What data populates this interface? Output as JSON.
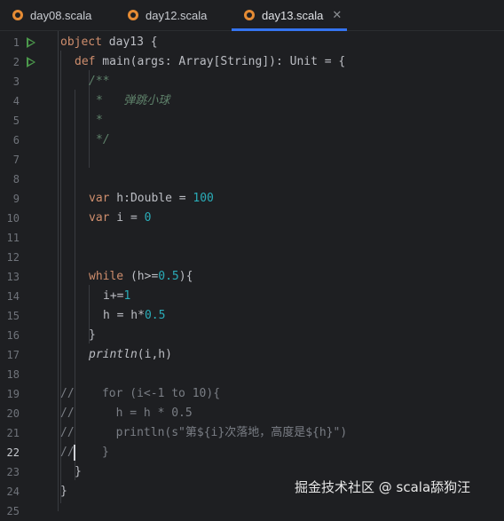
{
  "tabs": [
    {
      "label": "day08.scala",
      "active": false
    },
    {
      "label": "day12.scala",
      "active": false
    },
    {
      "label": "day13.scala",
      "active": true
    }
  ],
  "close_glyph": "✕",
  "line_numbers": [
    "1",
    "2",
    "3",
    "4",
    "5",
    "6",
    "7",
    "8",
    "9",
    "10",
    "11",
    "12",
    "13",
    "14",
    "15",
    "16",
    "17",
    "18",
    "19",
    "20",
    "21",
    "22",
    "23",
    "24",
    "25"
  ],
  "current_line": "22",
  "code": {
    "l1_kw": "object",
    "l1_rest": " day13 {",
    "l2_kw": "def",
    "l2_rest": " main(args: Array[String]): Unit = {",
    "l3": "/**",
    "l4_star": "*",
    "l4_text": "   弹跳小球",
    "l5": "*",
    "l6": "*/",
    "l9_kw": "var",
    "l9_mid": " h:Double = ",
    "l9_num": "100",
    "l10_kw": "var",
    "l10_mid": " i = ",
    "l10_num": "0",
    "l13_kw": "while",
    "l13_mid": " (h>=",
    "l13_num": "0.5",
    "l13_end": "){",
    "l14_mid": "i+=",
    "l14_num": "1",
    "l15_mid": "h = h*",
    "l15_num": "0.5",
    "l16": "}",
    "l17_fn": "println",
    "l17_rest": "(i,h)",
    "l19_slash": "//",
    "l19_text": "    for (i<-1 to 10){",
    "l20_slash": "//",
    "l20_text": "      h = h * 0.5",
    "l21_slash": "//",
    "l21_text": "      println(s\"第${i}次落地，高度是${h}\")",
    "l22_slash": "//",
    "l22_text": "    }",
    "l23": "}",
    "l24": "}"
  },
  "watermark": "掘金技术社区 @ scala舔狗汪",
  "colors": {
    "background": "#1e1f22",
    "keyword": "#cf8e6d",
    "number": "#2aacb8",
    "comment": "#7a7e85",
    "doc_comment": "#5f826b",
    "active_tab_underline": "#3574f0",
    "run_icon": "#4c9a4c"
  }
}
